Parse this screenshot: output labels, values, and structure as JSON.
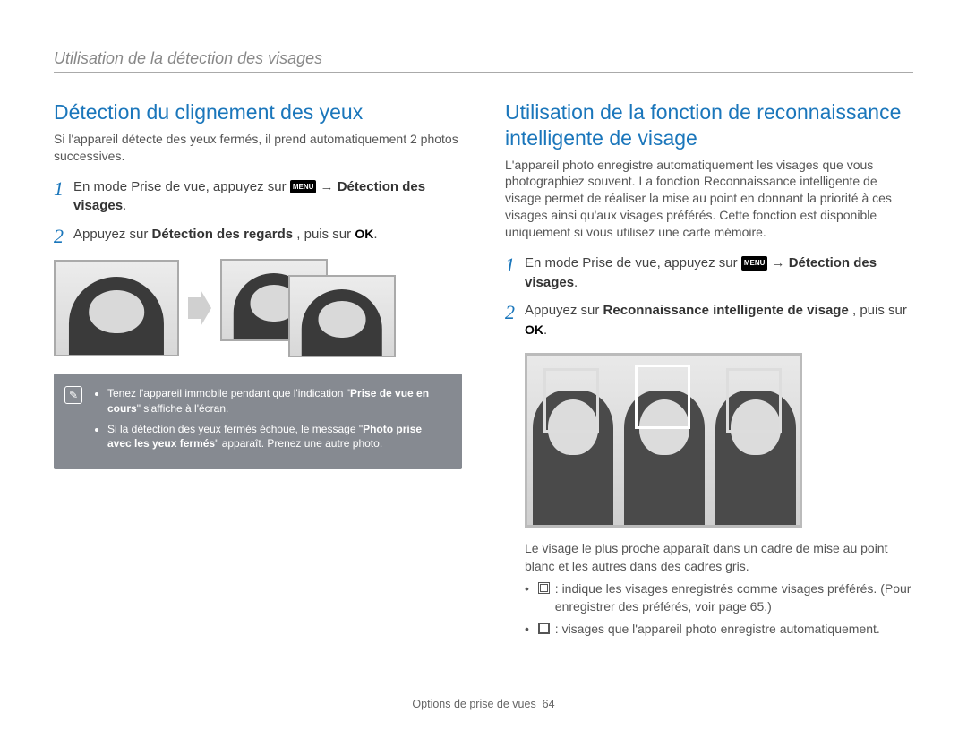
{
  "breadcrumb": "Utilisation de la détection des visages",
  "left": {
    "title": "Détection du clignement des yeux",
    "intro": "Si l'appareil détecte des yeux fermés, il prend automatiquement 2 photos successives.",
    "step1_a": "En mode Prise de vue, appuyez sur ",
    "menu_label": "MENU",
    "arrow": "→",
    "step1_b": " Détection des visages",
    "step2_a": "Appuyez sur ",
    "step2_bold": "Détection des regards",
    "step2_b": ", puis sur ",
    "ok": "OK",
    "note_bullets": [
      {
        "pre": "Tenez l'appareil immobile pendant que l'indication \"",
        "bold": "Prise de vue en cours",
        "post": "\" s'affiche à l'écran."
      },
      {
        "pre": "Si la détection des yeux fermés échoue, le message \"",
        "bold": "Photo prise avec les yeux fermés",
        "post": "\" apparaît. Prenez une autre photo."
      }
    ]
  },
  "right": {
    "title": "Utilisation de la fonction de reconnaissance intelligente de visage",
    "intro": "L'appareil photo enregistre automatiquement les visages que vous photographiez souvent. La fonction Reconnaissance intelligente de visage permet de réaliser la mise au point en donnant la priorité à ces visages ainsi qu'aux visages préférés. Cette fonction est disponible uniquement si vous utilisez une carte mémoire.",
    "step1_a": "En mode Prise de vue, appuyez sur ",
    "step1_b": " Détection des visages",
    "step2_a": "Appuyez sur ",
    "step2_bold": "Reconnaissance intelligente de visage",
    "step2_b": ", puis sur ",
    "after1": "Le visage le plus proche apparaît dans un cadre de mise au point blanc et les autres dans des cadres gris.",
    "bullet_pref": " : indique les visages enregistrés comme visages préférés. (Pour enregistrer des préférés, voir page 65.)",
    "bullet_auto": " : visages que l'appareil photo enregistre automatiquement."
  },
  "footer_section": "Options de prise de vues",
  "footer_page": "64"
}
